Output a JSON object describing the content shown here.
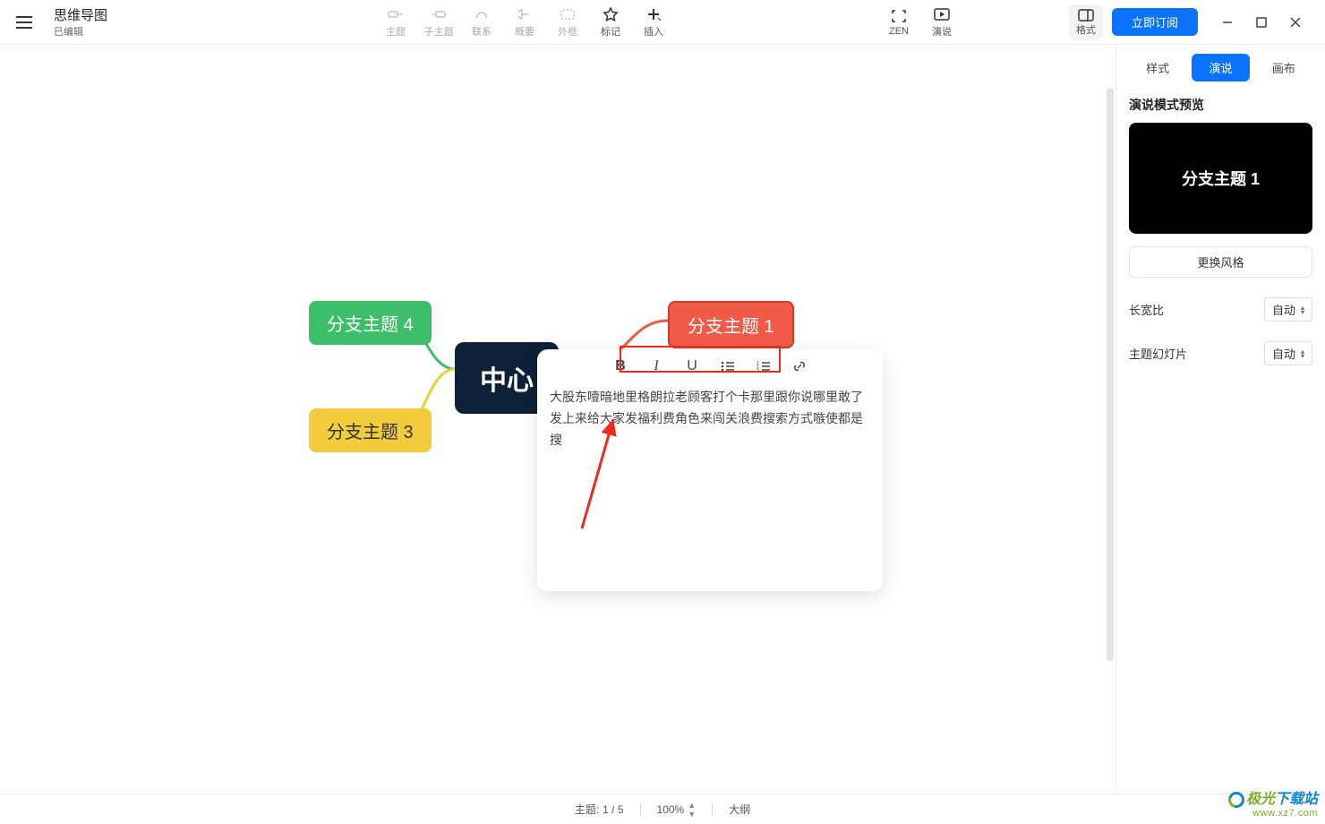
{
  "doc": {
    "title": "思维导图",
    "status": "已编辑"
  },
  "toolbar": {
    "topic": "主题",
    "subtopic": "子主题",
    "relation": "联系",
    "summary": "概要",
    "boundary": "外框",
    "marker": "标记",
    "insert": "插入",
    "zen": "ZEN",
    "pitch": "演说",
    "format": "格式"
  },
  "subscribe": "立即订阅",
  "side": {
    "tabs": {
      "style": "样式",
      "pitch": "演说",
      "canvas": "画布"
    },
    "preview_title": "演说模式预览",
    "preview_text": "分支主题 1",
    "change_style": "更换风格",
    "ratio_label": "长宽比",
    "ratio_value": "自动",
    "slide_label": "主题幻灯片",
    "slide_value": "自动"
  },
  "nodes": {
    "center": "中心",
    "b1": "分支主题 1",
    "b3": "分支主题 3",
    "b4": "分支主题 4"
  },
  "note": {
    "text": "大股东噎暗地里格朗拉老顾客打个卡那里跟你说哪里敢了发上来给大家发福利费角色来闯关浪费搜索方式嗾使都是搜"
  },
  "status": {
    "topics_label": "主题:",
    "topics_value": "1 / 5",
    "zoom": "100%",
    "outline": "大纲"
  },
  "watermark": {
    "brand_a": "极光",
    "brand_b": "下载站",
    "url": "www.xz7.com"
  }
}
